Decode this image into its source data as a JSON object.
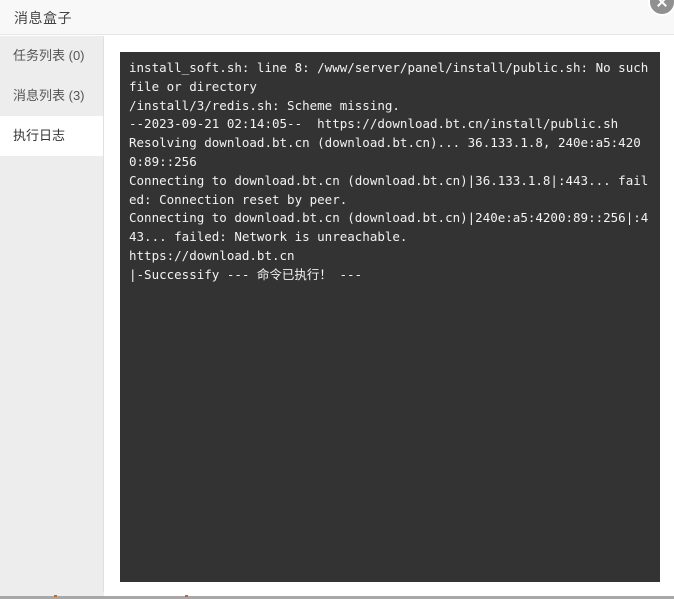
{
  "header": {
    "title": "消息盒子",
    "close_icon": "close-icon"
  },
  "sidebar": {
    "items": [
      {
        "label": "任务列表 (0)",
        "name": "task-list",
        "active": false
      },
      {
        "label": "消息列表 (3)",
        "name": "message-list",
        "active": false
      },
      {
        "label": "执行日志",
        "name": "execution-log",
        "active": true
      }
    ]
  },
  "terminal": {
    "background": "#333333",
    "text_color": "#f2f2f2",
    "lines": [
      "install_soft.sh: line 8: /www/server/panel/install/public.sh: No such file or directory",
      "/install/3/redis.sh: Scheme missing.",
      "--2023-09-21 02:14:05--  https://download.bt.cn/install/public.sh",
      "Resolving download.bt.cn (download.bt.cn)... 36.133.1.8, 240e:a5:4200:89::256",
      "Connecting to download.bt.cn (download.bt.cn)|36.133.1.8|:443... failed: Connection reset by peer.",
      "Connecting to download.bt.cn (download.bt.cn)|240e:a5:4200:89::256|:443... failed: Network is unreachable.",
      "https://download.bt.cn",
      "|-Successify --- 命令已执行！ ---"
    ]
  }
}
